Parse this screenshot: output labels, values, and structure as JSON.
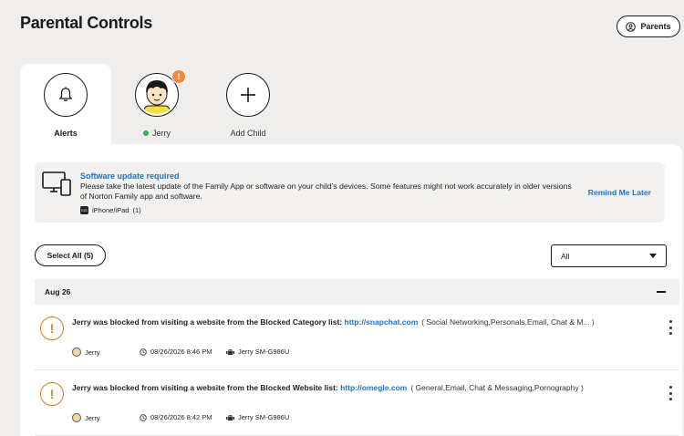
{
  "page": {
    "title": "Parental Controls"
  },
  "header": {
    "parents_label": "Parents"
  },
  "tabs": [
    {
      "label": "Alerts",
      "icon": "bell-icon",
      "active": true
    },
    {
      "label": "Jerry",
      "icon": "child-avatar",
      "badge": "!",
      "status": "online"
    },
    {
      "label": "Add Child",
      "icon": "plus-icon"
    }
  ],
  "update_card": {
    "title": "Software update required",
    "text": "Please take the latest update of the Family App or software on your child’s devices. Some features might not work accurately in older versions of Norton Family app and software.",
    "os_badge": "iOS",
    "device_label": "iPhone/iPad",
    "device_count": "(1)",
    "action": "Remind Me Later"
  },
  "toolbar": {
    "select_all": "Select All (5)",
    "filter_value": "All"
  },
  "groups": [
    {
      "date": "Aug 26",
      "alerts": [
        {
          "text": "Jerry was blocked from visiting a website from the Blocked Category list: ",
          "link": "http://snapchat.com",
          "categories": "( Social Networking,Personals,Email, Chat & M... )",
          "user": "Jerry",
          "time": "08/26/2026 8:46 PM",
          "device": "Jerry SM-G986U"
        },
        {
          "text": "Jerry was blocked from visiting a website from the Blocked Website list: ",
          "link": "http://omegle.com",
          "categories": "( General,Email, Chat & Messaging,Pornography )",
          "user": "Jerry",
          "time": "08/26/2026 8:42 PM",
          "device": "Jerry SM-G986U"
        }
      ]
    }
  ],
  "colors": {
    "accent_blue": "#1a73c9",
    "warning_orange": "#e07b24",
    "badge_orange": "#f08a3e",
    "online_green": "#3aab4f"
  }
}
